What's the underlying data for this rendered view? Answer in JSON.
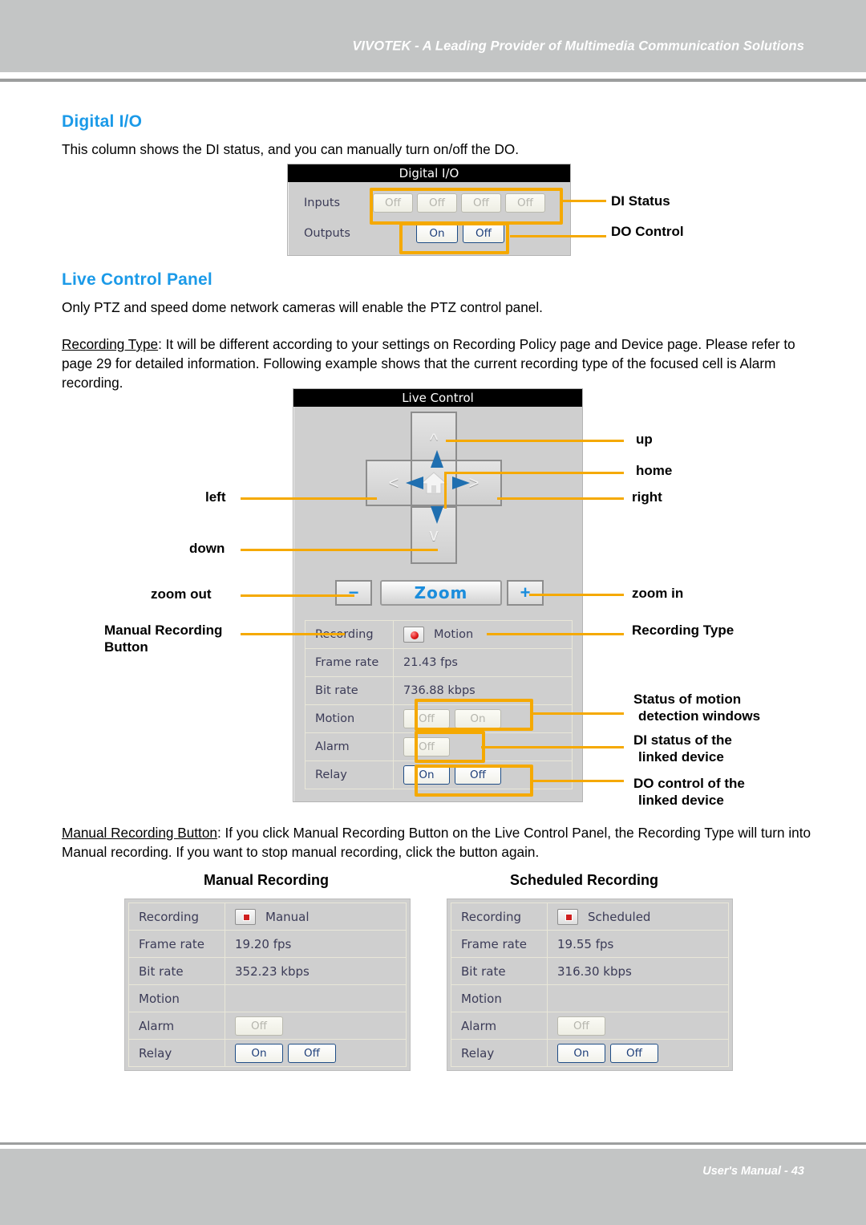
{
  "header": {
    "title": "VIVOTEK - A Leading Provider of Multimedia Communication Solutions"
  },
  "footer": {
    "text": "User's Manual - 43"
  },
  "sections": {
    "digital_io": {
      "heading": "Digital I/O",
      "description": "This column shows the DI status, and you can manually turn on/off the DO."
    },
    "live_control": {
      "heading": "Live Control Panel",
      "description": "Only PTZ and speed dome network cameras will enable the PTZ control panel.",
      "recording_type_term": "Recording Type",
      "recording_type_body": ": It will be different according to your settings on Recording Policy page and Device page. Please refer to page 29 for detailed information. Following example shows that the current recording type of the focused cell is Alarm recording."
    },
    "manual_recording": {
      "term": "Manual Recording Button",
      "body": ": If you click Manual Recording Button on the Live Control Panel, the Recording Type will turn into Manual recording. If you want to stop manual recording, click the button again."
    }
  },
  "digital_io_panel": {
    "title": "Digital I/O",
    "inputs_label": "Inputs",
    "outputs_label": "Outputs",
    "inputs": [
      "Off",
      "Off",
      "Off",
      "Off"
    ],
    "outputs": [
      "On",
      "Off"
    ],
    "callouts": {
      "di_status": "DI Status",
      "do_control": "DO Control"
    }
  },
  "live_control_panel": {
    "title": "Live Control",
    "ptz": {
      "up": "up",
      "down": "down",
      "left": "left",
      "right": "right",
      "home": "home"
    },
    "zoom": {
      "out_label": "−",
      "in_label": "+",
      "main_label": "Zoom"
    },
    "table": {
      "rows": [
        {
          "key": "Recording",
          "value": "Motion",
          "icon": "record-dot-icon"
        },
        {
          "key": "Frame rate",
          "value": "21.43 fps"
        },
        {
          "key": "Bit rate",
          "value": "736.88 kbps"
        },
        {
          "key": "Motion",
          "buttons": [
            "Off",
            "On"
          ]
        },
        {
          "key": "Alarm",
          "buttons": [
            "Off"
          ]
        },
        {
          "key": "Relay",
          "buttons": [
            "On",
            "Off"
          ]
        }
      ]
    },
    "callouts": {
      "up": "up",
      "home": "home",
      "right": "right",
      "left": "left",
      "down": "down",
      "zoom_out": "zoom out",
      "zoom_in": "zoom in",
      "manual_recording_button": "Manual Recording\nButton",
      "manual_recording_button_l1": "Manual Recording",
      "manual_recording_button_l2": "Button",
      "recording_type": "Recording Type",
      "motion_status_l1": "Status of motion",
      "motion_status_l2": "detection windows",
      "di_status_l1": "DI status of the",
      "di_status_l2": "linked device",
      "do_control_l1": "DO control of the",
      "do_control_l2": "linked device"
    }
  },
  "examples": [
    {
      "title": "Manual Recording",
      "rows": [
        {
          "key": "Recording",
          "value": "Manual",
          "icon": "record-square-icon"
        },
        {
          "key": "Frame rate",
          "value": "19.20 fps"
        },
        {
          "key": "Bit rate",
          "value": "352.23 kbps"
        },
        {
          "key": "Motion",
          "value": ""
        },
        {
          "key": "Alarm",
          "buttons": [
            "Off"
          ]
        },
        {
          "key": "Relay",
          "buttons": [
            "On",
            "Off"
          ]
        }
      ]
    },
    {
      "title": "Scheduled Recording",
      "rows": [
        {
          "key": "Recording",
          "value": "Scheduled",
          "icon": "record-square-icon"
        },
        {
          "key": "Frame rate",
          "value": "19.55 fps"
        },
        {
          "key": "Bit rate",
          "value": "316.30 kbps"
        },
        {
          "key": "Motion",
          "value": ""
        },
        {
          "key": "Alarm",
          "buttons": [
            "Off"
          ]
        },
        {
          "key": "Relay",
          "buttons": [
            "On",
            "Off"
          ]
        }
      ]
    }
  ],
  "colors": {
    "heading_blue": "#1b9ae8",
    "highlight_orange": "#f5a900",
    "band_gray": "#c3c5c5",
    "panel_gray": "#cfcfcf",
    "link_blue": "#1b8ddc",
    "record_red": "#e01b1b"
  }
}
